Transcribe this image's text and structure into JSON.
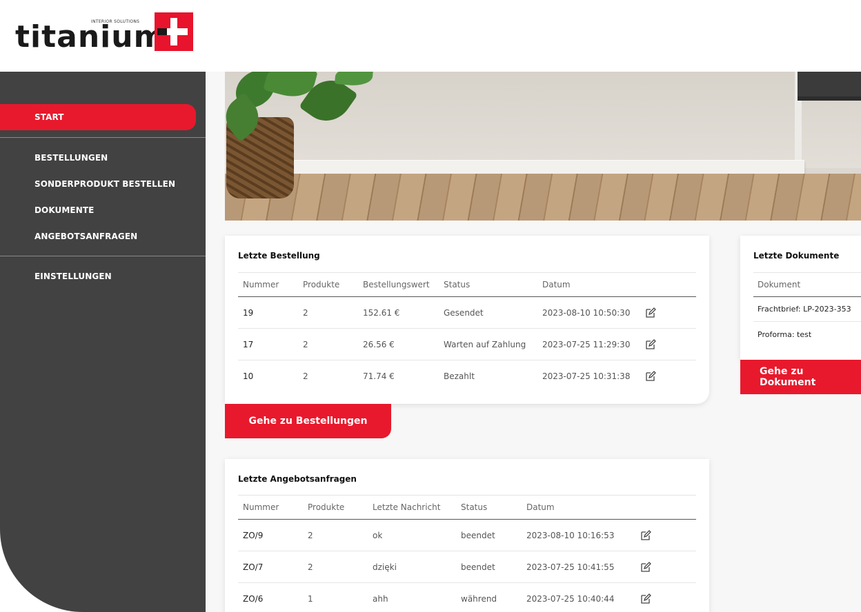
{
  "brand": {
    "name": "titanium",
    "tagline": "INTERIOR SOLUTIONS",
    "accent_color": "#e8192c"
  },
  "sidebar": {
    "items": [
      {
        "label": "START",
        "active": true
      },
      {
        "label": "BESTELLUNGEN",
        "active": false
      },
      {
        "label": "SONDERPRODUKT BESTELLEN",
        "active": false
      },
      {
        "label": "DOKUMENTE",
        "active": false
      },
      {
        "label": "ANGEBOTSANFRAGEN",
        "active": false
      },
      {
        "label": "EINSTELLUNGEN",
        "active": false
      }
    ]
  },
  "orders": {
    "title": "Letzte Bestellung",
    "columns": [
      "Nummer",
      "Produkte",
      "Bestellungswert",
      "Status",
      "Datum"
    ],
    "rows": [
      {
        "number": "19",
        "products": "2",
        "value": "152.61 €",
        "status": "Gesendet",
        "date": "2023-08-10 10:50:30"
      },
      {
        "number": "17",
        "products": "2",
        "value": "26.56 €",
        "status": "Warten auf Zahlung",
        "date": "2023-07-25 11:29:30"
      },
      {
        "number": "10",
        "products": "2",
        "value": "71.74 €",
        "status": "Bezahlt",
        "date": "2023-07-25 10:31:38"
      }
    ],
    "button_label": "Gehe zu Bestellungen"
  },
  "documents": {
    "title": "Letzte Dokumente",
    "columns": [
      "Dokument"
    ],
    "rows": [
      "Frachtbrief: LP-2023-353",
      "Proforma: test"
    ],
    "button_label": "Gehe zu Dokument"
  },
  "quotes": {
    "title": "Letzte Angebotsanfragen",
    "columns": [
      "Nummer",
      "Produkte",
      "Letzte Nachricht",
      "Status",
      "Datum"
    ],
    "rows": [
      {
        "number": "ZO/9",
        "products": "2",
        "message": "ok",
        "status": "beendet",
        "date": "2023-08-10 10:16:53"
      },
      {
        "number": "ZO/7",
        "products": "2",
        "message": "dzięki",
        "status": "beendet",
        "date": "2023-07-25 10:41:55"
      },
      {
        "number": "ZO/6",
        "products": "1",
        "message": "ahh",
        "status": "während",
        "date": "2023-07-25 10:40:44"
      }
    ]
  },
  "icons": {
    "edit": "edit-pencil-icon",
    "logo_mark": "swiss-cross-icon"
  }
}
